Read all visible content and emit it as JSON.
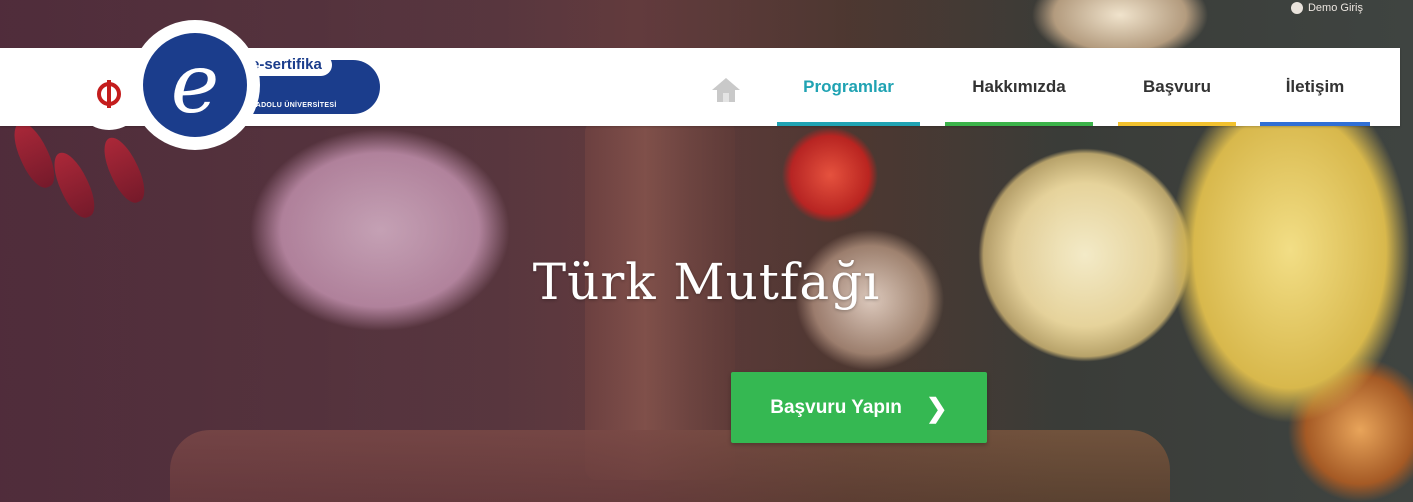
{
  "top_links": {
    "demo": "Demo Giriş"
  },
  "logo": {
    "brand": "e-sertifika",
    "university": "ANADOLU ÜNİVERSİTESİ",
    "letter": "e"
  },
  "nav": {
    "items": [
      {
        "label": "Programlar",
        "color": "#20a3b3",
        "active": true
      },
      {
        "label": "Hakkımızda",
        "color": "#3cb34a",
        "active": false
      },
      {
        "label": "Başvuru",
        "color": "#f2c12e",
        "active": false
      },
      {
        "label": "İletişim",
        "color": "#2f6fd6",
        "active": false
      }
    ],
    "home_icon": "home-icon"
  },
  "hero": {
    "title": "Türk Mutfağı",
    "cta_label": "Başvuru Yapın",
    "cta_icon": "chevron-right-icon",
    "cta_color": "#35b852"
  },
  "colors": {
    "brand_blue": "#1b3d8c",
    "brand_red": "#c41d1d"
  }
}
